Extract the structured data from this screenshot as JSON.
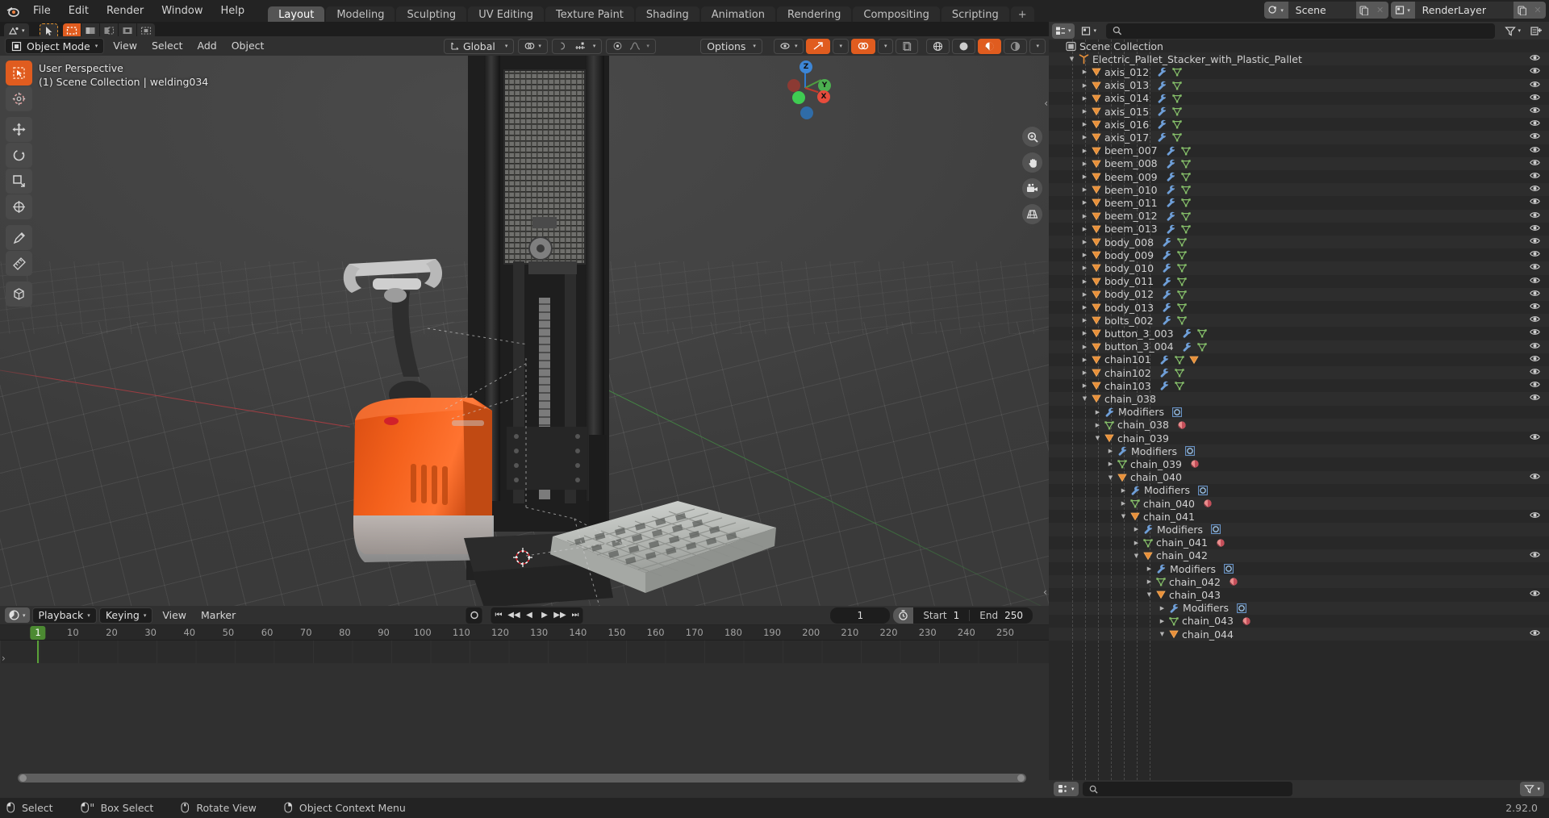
{
  "app": {
    "name": "Blender",
    "version": "2.92.0"
  },
  "topbar": {
    "menus": [
      "File",
      "Edit",
      "Render",
      "Window",
      "Help"
    ],
    "workspace_tabs": [
      {
        "label": "Layout",
        "active": true
      },
      {
        "label": "Modeling",
        "active": false
      },
      {
        "label": "Sculpting",
        "active": false
      },
      {
        "label": "UV Editing",
        "active": false
      },
      {
        "label": "Texture Paint",
        "active": false
      },
      {
        "label": "Shading",
        "active": false
      },
      {
        "label": "Animation",
        "active": false
      },
      {
        "label": "Rendering",
        "active": false
      },
      {
        "label": "Compositing",
        "active": false
      },
      {
        "label": "Scripting",
        "active": false
      }
    ],
    "add_workspace_label": "+",
    "scene_name": "Scene",
    "viewlayer_name": "RenderLayer"
  },
  "tool_header": {
    "mode": "Object Mode",
    "menus": [
      "View",
      "Select",
      "Add",
      "Object"
    ],
    "transform_orientation": "Global",
    "options_label": "Options"
  },
  "viewport": {
    "perspective_label": "User Perspective",
    "scene_info": "(1) Scene Collection | welding034",
    "gizmo_axes": [
      "X",
      "Y",
      "Z"
    ],
    "accent_orange": "#e05c1f",
    "axis_x_color": "#ac3c42",
    "axis_y_color": "#4f9a4f"
  },
  "timeline": {
    "editor_label": "Playback",
    "keying_label": "Keying",
    "menus": [
      "View",
      "Marker"
    ],
    "current_frame": "1",
    "start_label": "Start",
    "start_value": "1",
    "end_label": "End",
    "end_value": "250",
    "ticks": [
      "10",
      "20",
      "30",
      "40",
      "50",
      "60",
      "70",
      "80",
      "90",
      "100",
      "110",
      "120",
      "130",
      "140",
      "150",
      "160",
      "170",
      "180",
      "190",
      "200",
      "210",
      "220",
      "230",
      "240",
      "250"
    ],
    "playhead_label": "1"
  },
  "outliner": {
    "search_placeholder": "",
    "root": "Scene Collection",
    "rows": [
      {
        "indent": 0,
        "label": "Scene Collection",
        "tri": "",
        "icon": "collection-icon",
        "icons": [],
        "eye": false
      },
      {
        "indent": 1,
        "label": "Electric_Pallet_Stacker_with_Plastic_Pallet",
        "tri": "down",
        "icon": "empty-axis-icon",
        "icons": [],
        "eye": true
      },
      {
        "indent": 2,
        "label": "axis_012",
        "tri": "right",
        "icon": "mesh-object-icon",
        "icons": [
          "modifier-icon",
          "mesh-data-icon"
        ],
        "eye": true
      },
      {
        "indent": 2,
        "label": "axis_013",
        "tri": "right",
        "icon": "mesh-object-icon",
        "icons": [
          "modifier-icon",
          "mesh-data-icon"
        ],
        "eye": true
      },
      {
        "indent": 2,
        "label": "axis_014",
        "tri": "right",
        "icon": "mesh-object-icon",
        "icons": [
          "modifier-icon",
          "mesh-data-icon"
        ],
        "eye": true
      },
      {
        "indent": 2,
        "label": "axis_015",
        "tri": "right",
        "icon": "mesh-object-icon",
        "icons": [
          "modifier-icon",
          "mesh-data-icon"
        ],
        "eye": true
      },
      {
        "indent": 2,
        "label": "axis_016",
        "tri": "right",
        "icon": "mesh-object-icon",
        "icons": [
          "modifier-icon",
          "mesh-data-icon"
        ],
        "eye": true
      },
      {
        "indent": 2,
        "label": "axis_017",
        "tri": "right",
        "icon": "mesh-object-icon",
        "icons": [
          "modifier-icon",
          "mesh-data-icon"
        ],
        "eye": true
      },
      {
        "indent": 2,
        "label": "beem_007",
        "tri": "right",
        "icon": "mesh-object-icon",
        "icons": [
          "modifier-icon",
          "mesh-data-icon"
        ],
        "eye": true
      },
      {
        "indent": 2,
        "label": "beem_008",
        "tri": "right",
        "icon": "mesh-object-icon",
        "icons": [
          "modifier-icon",
          "mesh-data-icon"
        ],
        "eye": true
      },
      {
        "indent": 2,
        "label": "beem_009",
        "tri": "right",
        "icon": "mesh-object-icon",
        "icons": [
          "modifier-icon",
          "mesh-data-icon"
        ],
        "eye": true
      },
      {
        "indent": 2,
        "label": "beem_010",
        "tri": "right",
        "icon": "mesh-object-icon",
        "icons": [
          "modifier-icon",
          "mesh-data-icon"
        ],
        "eye": true
      },
      {
        "indent": 2,
        "label": "beem_011",
        "tri": "right",
        "icon": "mesh-object-icon",
        "icons": [
          "modifier-icon",
          "mesh-data-icon"
        ],
        "eye": true
      },
      {
        "indent": 2,
        "label": "beem_012",
        "tri": "right",
        "icon": "mesh-object-icon",
        "icons": [
          "modifier-icon",
          "mesh-data-icon"
        ],
        "eye": true
      },
      {
        "indent": 2,
        "label": "beem_013",
        "tri": "right",
        "icon": "mesh-object-icon",
        "icons": [
          "modifier-icon",
          "mesh-data-icon"
        ],
        "eye": true
      },
      {
        "indent": 2,
        "label": "body_008",
        "tri": "right",
        "icon": "mesh-object-icon",
        "icons": [
          "modifier-icon",
          "mesh-data-icon"
        ],
        "eye": true
      },
      {
        "indent": 2,
        "label": "body_009",
        "tri": "right",
        "icon": "mesh-object-icon",
        "icons": [
          "modifier-icon",
          "mesh-data-icon"
        ],
        "eye": true
      },
      {
        "indent": 2,
        "label": "body_010",
        "tri": "right",
        "icon": "mesh-object-icon",
        "icons": [
          "modifier-icon",
          "mesh-data-icon"
        ],
        "eye": true
      },
      {
        "indent": 2,
        "label": "body_011",
        "tri": "right",
        "icon": "mesh-object-icon",
        "icons": [
          "modifier-icon",
          "mesh-data-icon"
        ],
        "eye": true
      },
      {
        "indent": 2,
        "label": "body_012",
        "tri": "right",
        "icon": "mesh-object-icon",
        "icons": [
          "modifier-icon",
          "mesh-data-icon"
        ],
        "eye": true
      },
      {
        "indent": 2,
        "label": "body_013",
        "tri": "right",
        "icon": "mesh-object-icon",
        "icons": [
          "modifier-icon",
          "mesh-data-icon"
        ],
        "eye": true
      },
      {
        "indent": 2,
        "label": "bolts_002",
        "tri": "right",
        "icon": "mesh-object-icon",
        "icons": [
          "modifier-icon",
          "mesh-data-icon"
        ],
        "eye": true
      },
      {
        "indent": 2,
        "label": "button_3_003",
        "tri": "right",
        "icon": "mesh-object-icon",
        "icons": [
          "modifier-icon",
          "mesh-data-icon"
        ],
        "eye": true
      },
      {
        "indent": 2,
        "label": "button_3_004",
        "tri": "right",
        "icon": "mesh-object-icon",
        "icons": [
          "modifier-icon",
          "mesh-data-icon"
        ],
        "eye": true
      },
      {
        "indent": 2,
        "label": "chain101",
        "tri": "right",
        "icon": "mesh-object-icon",
        "icons": [
          "modifier-icon",
          "mesh-data-icon",
          "child-object-icon"
        ],
        "eye": true
      },
      {
        "indent": 2,
        "label": "chain102",
        "tri": "right",
        "icon": "mesh-object-icon",
        "icons": [
          "modifier-icon",
          "mesh-data-icon"
        ],
        "eye": true
      },
      {
        "indent": 2,
        "label": "chain103",
        "tri": "right",
        "icon": "mesh-object-icon",
        "icons": [
          "modifier-icon",
          "mesh-data-icon"
        ],
        "eye": true
      },
      {
        "indent": 2,
        "label": "chain_038",
        "tri": "down",
        "icon": "mesh-object-icon",
        "icons": [],
        "eye": true
      },
      {
        "indent": 3,
        "label": "Modifiers",
        "tri": "right",
        "icon": "modifier-icon",
        "icons": [
          "subsurf-icon"
        ],
        "eye": false
      },
      {
        "indent": 3,
        "label": "chain_038",
        "tri": "right",
        "icon": "mesh-data-icon",
        "icons": [
          "material-icon"
        ],
        "eye": false
      },
      {
        "indent": 3,
        "label": "chain_039",
        "tri": "down",
        "icon": "mesh-object-icon",
        "icons": [],
        "eye": true
      },
      {
        "indent": 4,
        "label": "Modifiers",
        "tri": "right",
        "icon": "modifier-icon",
        "icons": [
          "subsurf-icon"
        ],
        "eye": false
      },
      {
        "indent": 4,
        "label": "chain_039",
        "tri": "right",
        "icon": "mesh-data-icon",
        "icons": [
          "material-icon"
        ],
        "eye": false
      },
      {
        "indent": 4,
        "label": "chain_040",
        "tri": "down",
        "icon": "mesh-object-icon",
        "icons": [],
        "eye": true
      },
      {
        "indent": 5,
        "label": "Modifiers",
        "tri": "right",
        "icon": "modifier-icon",
        "icons": [
          "subsurf-icon"
        ],
        "eye": false
      },
      {
        "indent": 5,
        "label": "chain_040",
        "tri": "right",
        "icon": "mesh-data-icon",
        "icons": [
          "material-icon"
        ],
        "eye": false
      },
      {
        "indent": 5,
        "label": "chain_041",
        "tri": "down",
        "icon": "mesh-object-icon",
        "icons": [],
        "eye": true
      },
      {
        "indent": 6,
        "label": "Modifiers",
        "tri": "right",
        "icon": "modifier-icon",
        "icons": [
          "subsurf-icon"
        ],
        "eye": false
      },
      {
        "indent": 6,
        "label": "chain_041",
        "tri": "right",
        "icon": "mesh-data-icon",
        "icons": [
          "material-icon"
        ],
        "eye": false
      },
      {
        "indent": 6,
        "label": "chain_042",
        "tri": "down",
        "icon": "mesh-object-icon",
        "icons": [],
        "eye": true
      },
      {
        "indent": 7,
        "label": "Modifiers",
        "tri": "right",
        "icon": "modifier-icon",
        "icons": [
          "subsurf-icon"
        ],
        "eye": false
      },
      {
        "indent": 7,
        "label": "chain_042",
        "tri": "right",
        "icon": "mesh-data-icon",
        "icons": [
          "material-icon"
        ],
        "eye": false
      },
      {
        "indent": 7,
        "label": "chain_043",
        "tri": "down",
        "icon": "mesh-object-icon",
        "icons": [],
        "eye": true
      },
      {
        "indent": 8,
        "label": "Modifiers",
        "tri": "right",
        "icon": "modifier-icon",
        "icons": [
          "subsurf-icon"
        ],
        "eye": false
      },
      {
        "indent": 8,
        "label": "chain_043",
        "tri": "right",
        "icon": "mesh-data-icon",
        "icons": [
          "material-icon"
        ],
        "eye": false
      },
      {
        "indent": 8,
        "label": "chain_044",
        "tri": "down",
        "icon": "mesh-object-icon",
        "icons": [],
        "eye": true
      }
    ]
  },
  "statusbar": {
    "items": [
      {
        "mouse": "left",
        "label": "Select"
      },
      {
        "mouse": "left-drag",
        "label": "Box Select"
      },
      {
        "mouse": "middle",
        "label": "Rotate View"
      },
      {
        "mouse": "right",
        "label": "Object Context Menu"
      }
    ]
  }
}
